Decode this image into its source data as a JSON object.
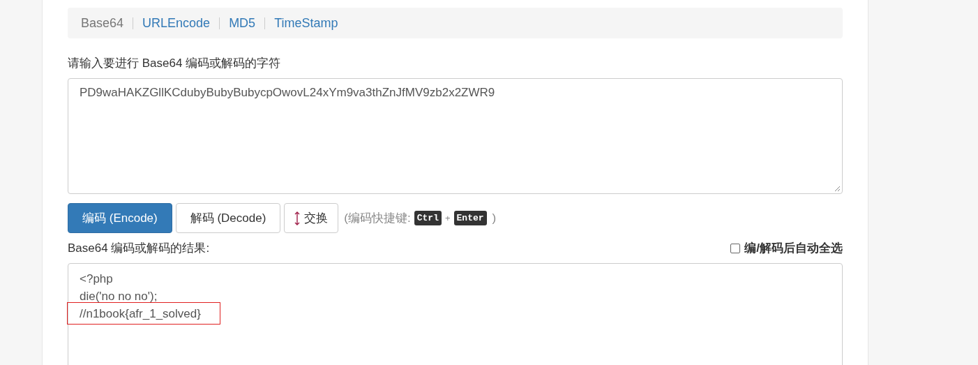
{
  "tabs": [
    {
      "label": "Base64",
      "selected": true
    },
    {
      "label": "URLEncode",
      "selected": false
    },
    {
      "label": "MD5",
      "selected": false
    },
    {
      "label": "TimeStamp",
      "selected": false
    }
  ],
  "input": {
    "label": "请输入要进行 Base64 编码或解码的字符",
    "value": "PD9waHAKZGllKCdubyBubyBubycpOwovL24xYm9va3thZnJfMV9zb2x2ZWR9"
  },
  "buttons": [
    {
      "label": "编码 (Encode)",
      "kind": "primary"
    },
    {
      "label": "解码 (Decode)",
      "kind": "default"
    },
    {
      "label": "交换",
      "kind": "swap"
    }
  ],
  "shortcut": {
    "prefix": "(编码快捷键:",
    "keys": [
      "Ctrl",
      "Enter"
    ],
    "joiner": "+",
    "suffix": ")"
  },
  "output": {
    "label": "Base64 编码或解码的结果:",
    "auto_select": {
      "label": "编/解码后自动全选",
      "checked": false
    },
    "lines": [
      {
        "text": "<?php",
        "highlighted": false
      },
      {
        "text": "die('no no no');",
        "highlighted": false
      },
      {
        "text": "//n1book{afr_1_solved}",
        "highlighted": true
      }
    ]
  }
}
